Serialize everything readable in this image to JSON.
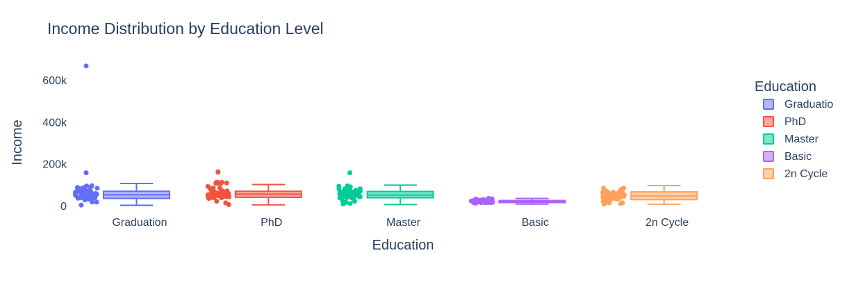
{
  "chart_data": {
    "type": "box",
    "title": "Income Distribution by Education Level",
    "xlabel": "Education",
    "ylabel": "Income",
    "ylim": [
      0,
      720000
    ],
    "y_ticks": [
      0,
      200000,
      400000,
      600000
    ],
    "y_tick_labels": [
      "0",
      "200k",
      "400k",
      "600k"
    ],
    "boxpoints": "all",
    "grid": false,
    "legend_title": "Education",
    "legend_position": "right",
    "categories": [
      "Graduation",
      "PhD",
      "Master",
      "Basic",
      "2n Cycle"
    ],
    "legend_labels": [
      "Graduatio",
      "PhD",
      "Master",
      "Basic",
      "2n Cycle"
    ],
    "series": [
      {
        "name": "Graduation",
        "color": "#636efa",
        "min": 2000,
        "q1": 35000,
        "median": 52000,
        "q3": 69000,
        "max": 106000,
        "outliers": [
          666666,
          157000
        ],
        "points_range": [
          1700,
          98000
        ]
      },
      {
        "name": "PhD",
        "color": "#ef553b",
        "min": 4000,
        "q1": 40000,
        "median": 55000,
        "q3": 69000,
        "max": 101000,
        "outliers": [
          162000,
          160000
        ],
        "points_range": [
          4000,
          113000
        ]
      },
      {
        "name": "Master",
        "color": "#00cc96",
        "min": 6000,
        "q1": 38000,
        "median": 51000,
        "q3": 68000,
        "max": 98000,
        "outliers": [
          157000
        ],
        "points_range": [
          6000,
          98000
        ]
      },
      {
        "name": "Basic",
        "color": "#ab63fa",
        "min": 7500,
        "q1": 15000,
        "median": 21000,
        "q3": 25000,
        "max": 35000,
        "outliers": [],
        "points_range": [
          7500,
          35000
        ]
      },
      {
        "name": "2n Cycle",
        "color": "#ffa15a",
        "min": 7500,
        "q1": 29000,
        "median": 46000,
        "q3": 66000,
        "max": 96000,
        "outliers": [],
        "points_range": [
          7500,
          96000
        ]
      }
    ]
  }
}
